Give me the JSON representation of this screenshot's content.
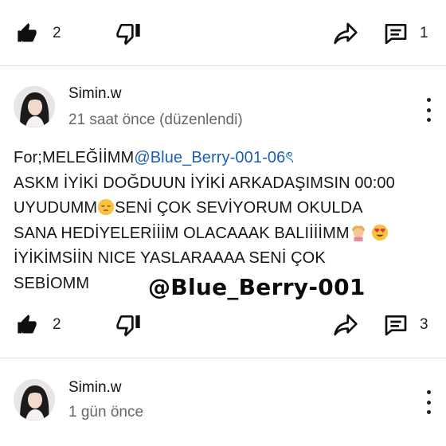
{
  "top_actions": {
    "likes": "2",
    "replies": "1"
  },
  "comment1": {
    "author": "Simin.w",
    "time": "21 saat önce (düzenlendi)",
    "prefix": "For;MELEĞİİMM",
    "mention": "@Blue_Berry-001-06ৎ",
    "line2": "ASKM İYİKİ DOĞDUUN İYİKİ ARKADAŞIMSIN 00:00",
    "line3a": "UYUDUMM",
    "line3b": "SENİ ÇOK SEVİYORUM OKULDA",
    "line4": "SANA HEDİYELERİİİM OLACAAAK BALIİİİMM",
    "line5": "İYİKİMSİİN NICE YASLARAAAA SENİ ÇOK",
    "line6": "SEBİOMM",
    "likes": "2",
    "replies": "3"
  },
  "watermark": "@Blue_Berry-001",
  "comment2": {
    "author": "Simin.w",
    "time": "1 gün önce"
  },
  "icons": [
    "like-icon",
    "dislike-icon",
    "share-icon",
    "reply-icon",
    "more-options-icon"
  ]
}
